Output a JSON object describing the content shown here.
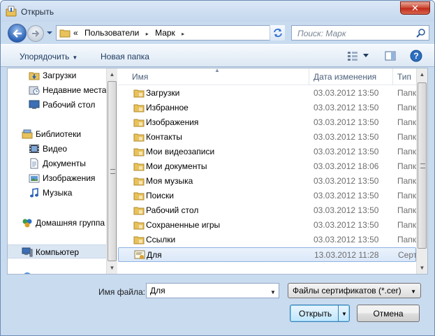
{
  "window": {
    "title": "Открыть",
    "close_glyph": "✕"
  },
  "nav": {
    "breadcrumb_prefix": "«",
    "breadcrumb": [
      "Пользователи",
      "Марк"
    ],
    "breadcrumb_separator": "▸",
    "search_placeholder": "Поиск: Марк"
  },
  "toolbar": {
    "organize_label": "Упорядочить",
    "new_folder_label": "Новая папка"
  },
  "sidebar": {
    "items": [
      {
        "label": "Загрузки",
        "icon": "downloads-folder-icon"
      },
      {
        "label": "Недавние места",
        "icon": "recent-places-icon"
      },
      {
        "label": "Рабочий стол",
        "icon": "desktop-icon"
      },
      {
        "label": "Библиотеки",
        "icon": "libraries-icon"
      },
      {
        "label": "Видео",
        "icon": "video-icon"
      },
      {
        "label": "Документы",
        "icon": "documents-icon"
      },
      {
        "label": "Изображения",
        "icon": "pictures-icon"
      },
      {
        "label": "Музыка",
        "icon": "music-icon"
      },
      {
        "label": "Домашняя группа",
        "icon": "homegroup-icon"
      },
      {
        "label": "Компьютер",
        "icon": "computer-icon"
      }
    ]
  },
  "files": {
    "columns": {
      "name": "Имя",
      "date": "Дата изменения",
      "type": "Тип"
    },
    "rows": [
      {
        "name": "Загрузки",
        "date": "03.03.2012 13:50",
        "type": "Папка",
        "icon": "downloads-folder-icon"
      },
      {
        "name": "Избранное",
        "date": "03.03.2012 13:50",
        "type": "Папка",
        "icon": "favorites-folder-icon"
      },
      {
        "name": "Изображения",
        "date": "03.03.2012 13:50",
        "type": "Папка",
        "icon": "pictures-folder-icon"
      },
      {
        "name": "Контакты",
        "date": "03.03.2012 13:50",
        "type": "Папка",
        "icon": "contacts-folder-icon"
      },
      {
        "name": "Мои видеозаписи",
        "date": "03.03.2012 13:50",
        "type": "Папка",
        "icon": "videos-folder-icon"
      },
      {
        "name": "Мои документы",
        "date": "03.03.2012 18:06",
        "type": "Папка",
        "icon": "documents-folder-icon"
      },
      {
        "name": "Моя музыка",
        "date": "03.03.2012 13:50",
        "type": "Папка",
        "icon": "music-folder-icon"
      },
      {
        "name": "Поиски",
        "date": "03.03.2012 13:50",
        "type": "Папка",
        "icon": "searches-folder-icon"
      },
      {
        "name": "Рабочий стол",
        "date": "03.03.2012 13:50",
        "type": "Папка",
        "icon": "desktop-folder-icon"
      },
      {
        "name": "Сохраненные игры",
        "date": "03.03.2012 13:50",
        "type": "Папка",
        "icon": "saved-games-folder-icon"
      },
      {
        "name": "Ссылки",
        "date": "03.03.2012 13:50",
        "type": "Папка",
        "icon": "links-folder-icon"
      },
      {
        "name": "Для",
        "date": "13.03.2012 11:28",
        "type": "Серти",
        "icon": "certificate-file-icon",
        "selected": true
      }
    ]
  },
  "footer": {
    "filename_label": "Имя файла:",
    "filename_value": "Для",
    "filter_value": "Файлы сертификатов (*.cer)",
    "open_label": "Открыть",
    "cancel_label": "Отмена"
  },
  "colors": {
    "folder": "#e8c25a",
    "selection": "#dbe8f8",
    "accent": "#3c7fb1"
  }
}
